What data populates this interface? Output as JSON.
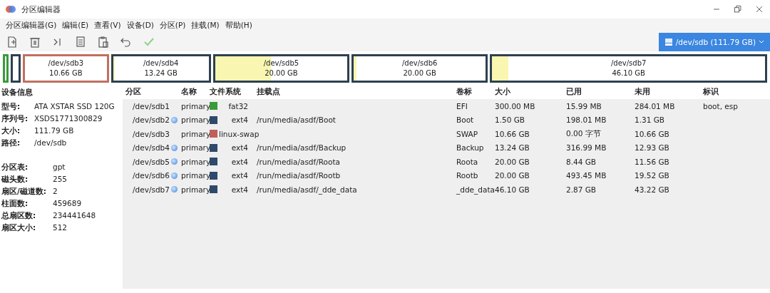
{
  "window": {
    "title": "分区编辑器"
  },
  "menu": [
    "分区编辑器(G)",
    "编辑(E)",
    "查看(V)",
    "设备(D)",
    "分区(P)",
    "挂载(M)",
    "帮助(H)"
  ],
  "device_selector": {
    "label": "/dev/sdb (111.79 GB)"
  },
  "disk_map": [
    {
      "kind": "compact",
      "color": "#3a9a3a"
    },
    {
      "kind": "compact",
      "color": "#2e4050"
    },
    {
      "kind": "labeled",
      "name": "/dev/sdb3",
      "size": "10.66 GB",
      "color": "#c07060",
      "level": 0
    },
    {
      "kind": "labeled",
      "name": "/dev/sdb4",
      "size": "13.24 GB",
      "color": "#2e4050",
      "level": 0.02
    },
    {
      "kind": "labeled",
      "name": "/dev/sdb5",
      "size": "20.00 GB",
      "color": "#2e4050",
      "level": 0.42
    },
    {
      "kind": "labeled",
      "name": "/dev/sdb6",
      "size": "20.00 GB",
      "color": "#2e4050",
      "level": 0.02
    },
    {
      "kind": "labeled",
      "name": "/dev/sdb7",
      "size": "46.10 GB",
      "color": "#2e4050",
      "level": 0.06
    }
  ],
  "device_info": {
    "title": "设备信息",
    "groups": [
      [
        {
          "label": "型号:",
          "value": "ATA XSTAR SSD 120G"
        },
        {
          "label": "序列号:",
          "value": "XSDS1771300829"
        },
        {
          "label": "大小:",
          "value": "111.79 GB"
        },
        {
          "label": "路径:",
          "value": "/dev/sdb"
        }
      ],
      [
        {
          "label": "分区表:",
          "value": "gpt"
        },
        {
          "label": "磁头数:",
          "value": "255"
        },
        {
          "label": "扇区/磁道数:",
          "value": "2"
        },
        {
          "label": "柱面数:",
          "value": "459689"
        },
        {
          "label": "总扇区数:",
          "value": "234441648"
        },
        {
          "label": "扇区大小:",
          "value": "512"
        }
      ]
    ]
  },
  "table": {
    "columns": [
      "分区",
      "名称",
      "文件系统",
      "挂载点",
      "卷标",
      "大小",
      "已用",
      "未用",
      "标识"
    ],
    "rows": [
      {
        "partition": "/dev/sdb1",
        "mounted": false,
        "name": "primary",
        "color": "#3a9a3a",
        "filesystem": "fat32",
        "label": "EFI",
        "size": "300.00 MB",
        "used": "15.99 MB",
        "unused": "284.01 MB",
        "flags": "boot, esp"
      },
      {
        "partition": "/dev/sdb2",
        "mounted": true,
        "name": "primary",
        "color": "#2e4a6a",
        "filesystem": "ext4",
        "mount_point": "/run/media/asdf/Boot",
        "label": "Boot",
        "size": "1.50 GB",
        "used": "198.01 MB",
        "unused": "1.31 GB"
      },
      {
        "partition": "/dev/sdb3",
        "mounted": false,
        "name": "primary",
        "color": "#c0605a",
        "filesystem": "linux-swap",
        "label": "SWAP",
        "size": "10.66 GB",
        "used": "0.00 字节",
        "unused": "10.66 GB"
      },
      {
        "partition": "/dev/sdb4",
        "mounted": true,
        "name": "primary",
        "color": "#2e4a6a",
        "filesystem": "ext4",
        "mount_point": "/run/media/asdf/Backup",
        "label": "Backup",
        "size": "13.24 GB",
        "used": "316.99 MB",
        "unused": "12.93 GB"
      },
      {
        "partition": "/dev/sdb5",
        "mounted": true,
        "name": "primary",
        "color": "#2e4a6a",
        "filesystem": "ext4",
        "mount_point": "/run/media/asdf/Roota",
        "label": "Roota",
        "size": "20.00 GB",
        "used": "8.44 GB",
        "unused": "11.56 GB"
      },
      {
        "partition": "/dev/sdb6",
        "mounted": true,
        "name": "primary",
        "color": "#2e4a6a",
        "filesystem": "ext4",
        "mount_point": "/run/media/asdf/Rootb",
        "label": "Rootb",
        "size": "20.00 GB",
        "used": "493.45 MB",
        "unused": "19.52 GB"
      },
      {
        "partition": "/dev/sdb7",
        "mounted": true,
        "name": "primary",
        "color": "#2e4a6a",
        "filesystem": "ext4",
        "mount_point": "/run/media/asdf/_dde_data",
        "label": "_dde_data",
        "size": "46.10 GB",
        "used": "2.87 GB",
        "unused": "43.22 GB"
      }
    ]
  }
}
